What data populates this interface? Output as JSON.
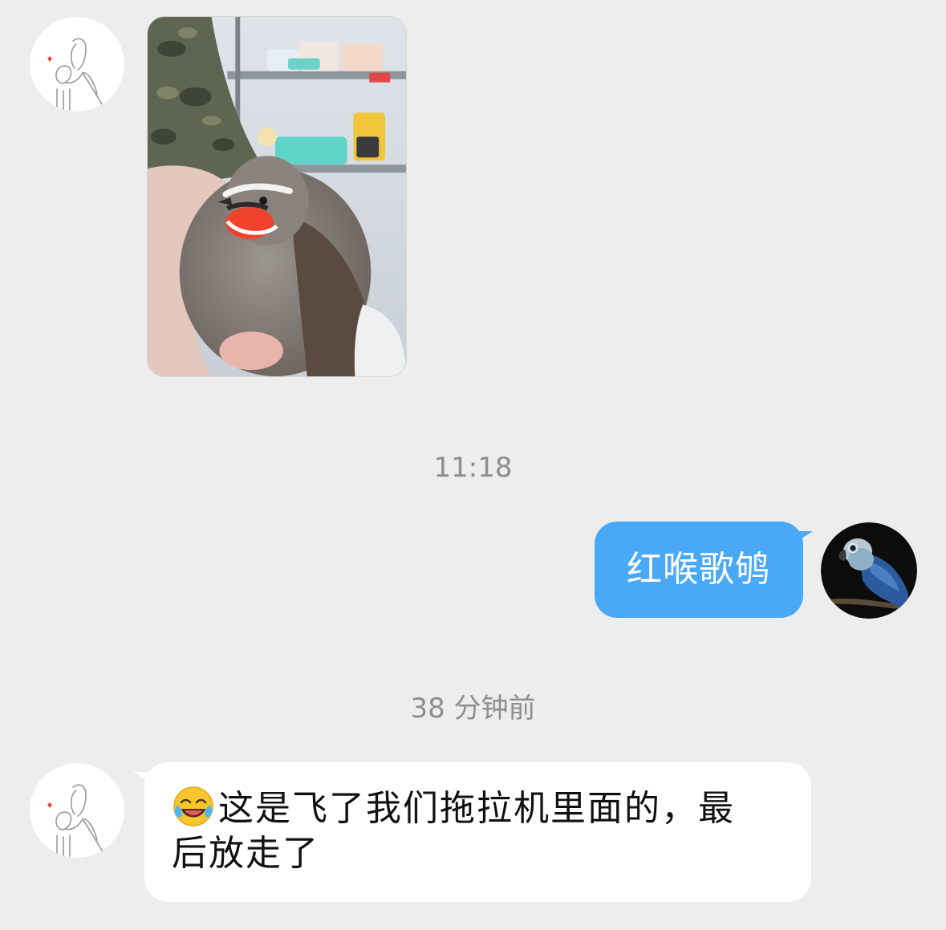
{
  "messages": [
    {
      "direction": "incoming",
      "type": "image",
      "avatar_icon": "line-art-figure-avatar-icon",
      "image_subject": "hand-holding-red-throated-bird-photo"
    },
    {
      "type": "timestamp",
      "text": "11:18"
    },
    {
      "direction": "outgoing",
      "type": "text",
      "text": "红喉歌鸲",
      "avatar_icon": "blue-parrot-avatar-icon"
    },
    {
      "type": "timestamp",
      "text": "38 分钟前"
    },
    {
      "direction": "incoming",
      "type": "text",
      "emoji_icon": "laughing-crying-emoji-icon",
      "text_line1": "这是飞了我们拖拉机里面的，最",
      "text_line2": "后放走了",
      "avatar_icon": "line-art-figure-avatar-icon"
    }
  ],
  "colors": {
    "background": "#ededed",
    "outgoing_bubble": "#4aa9f7",
    "incoming_bubble": "#ffffff",
    "timestamp_text": "#8e8e8e"
  }
}
